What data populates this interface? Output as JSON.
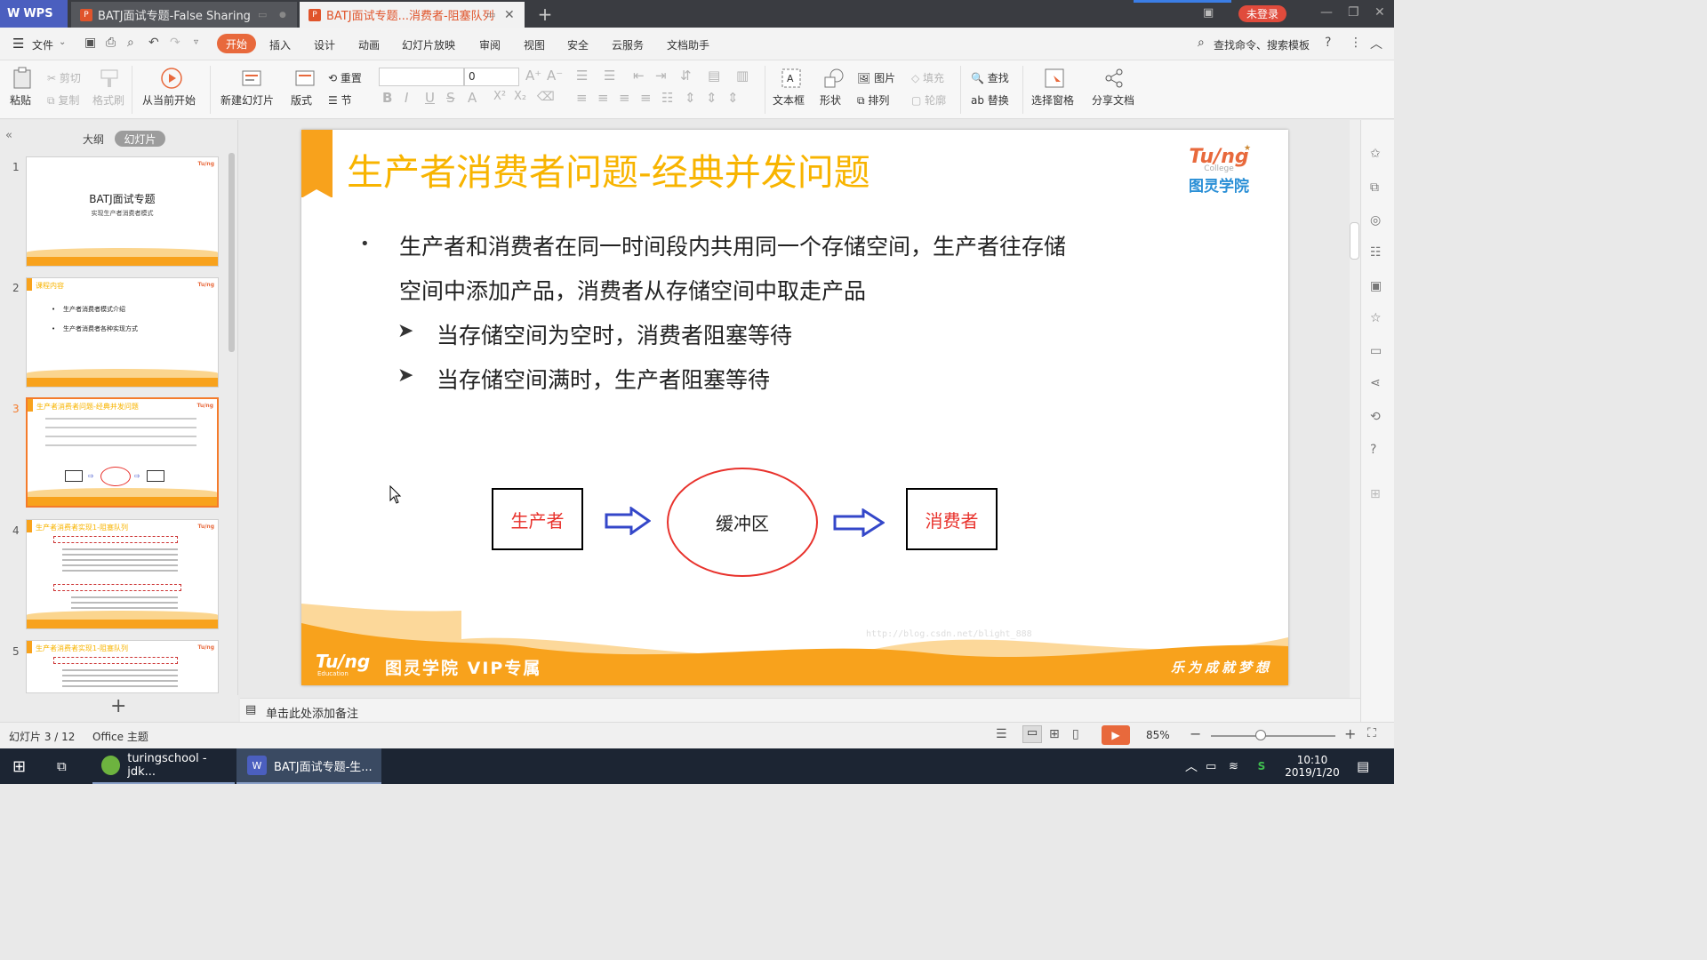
{
  "titlebar": {
    "app_name": "WPS",
    "tabs": [
      {
        "label": "BATJ面试专题-False Sharing",
        "active": false
      },
      {
        "label": "BATJ面试专题...消费者-阻塞队列",
        "active": true
      }
    ],
    "new_tab": "+",
    "login_label": "未登录"
  },
  "menubar": {
    "file_label": "文件",
    "items": [
      "开始",
      "插入",
      "设计",
      "动画",
      "幻灯片放映",
      "审阅",
      "视图",
      "安全",
      "云服务",
      "文档助手"
    ],
    "search_label": "查找命令、搜索模板"
  },
  "ribbon": {
    "paste": "粘贴",
    "cut": "剪切",
    "copy": "复制",
    "format_painter": "格式刷",
    "from_current": "从当前开始",
    "new_slide": "新建幻灯片",
    "layout": "版式",
    "reset": "重置",
    "section": "节",
    "font_size": "0",
    "textbox": "文本框",
    "shape": "形状",
    "picture": "图片",
    "arrange": "排列",
    "fill": "填充",
    "outline": "轮廓",
    "find": "查找",
    "replace": "替换",
    "selection_pane": "选择窗格",
    "share_doc": "分享文档"
  },
  "leftpanel": {
    "tab_outline": "大纲",
    "tab_slides": "幻灯片",
    "thumbs": [
      {
        "num": "1",
        "title": "BATJ面试专题",
        "subtitle": "实现生产者消费者模式"
      },
      {
        "num": "2",
        "title": "课程内容",
        "items": [
          "生产者消费者模式介绍",
          "生产者消费者各种实现方式"
        ]
      },
      {
        "num": "3",
        "title": "生产者消费者问题-经典并发问题"
      },
      {
        "num": "4",
        "title": "生产者消费者实现1-阻塞队列"
      },
      {
        "num": "5",
        "title": "生产者消费者实现1-阻塞队列"
      }
    ],
    "add_slide": "+"
  },
  "slide": {
    "title": "生产者消费者问题-经典并发问题",
    "bullet_main_line1": "生产者和消费者在同一时间段内共用同一个存储空间，生产者往存储",
    "bullet_main_line2": "空间中添加产品，消费者从存储空间中取走产品",
    "sub_bullets": [
      "当存储空间为空时，消费者阻塞等待",
      "当存储空间满时，生产者阻塞等待"
    ],
    "producer": "生产者",
    "buffer": "缓冲区",
    "consumer": "消费者",
    "logo_top": "Tu/ng",
    "logo_college": "College",
    "logo_cn": "图灵学院",
    "footer_logo": "Tu/ng",
    "footer_edu": "Education",
    "footer_text": "图灵学院  VIP专属",
    "footer_slogan": "乐为成就梦想",
    "watermark": "http://blog.csdn.net/blight_888"
  },
  "notes_placeholder": "单击此处添加备注",
  "status": {
    "slide_info": "幻灯片 3 / 12",
    "theme": "Office 主题",
    "zoom": "85%"
  },
  "taskbar": {
    "app1": "turingschool - jdk...",
    "app2": "BATJ面试专题-生...",
    "time": "10:10",
    "date": "2019/1/20"
  }
}
